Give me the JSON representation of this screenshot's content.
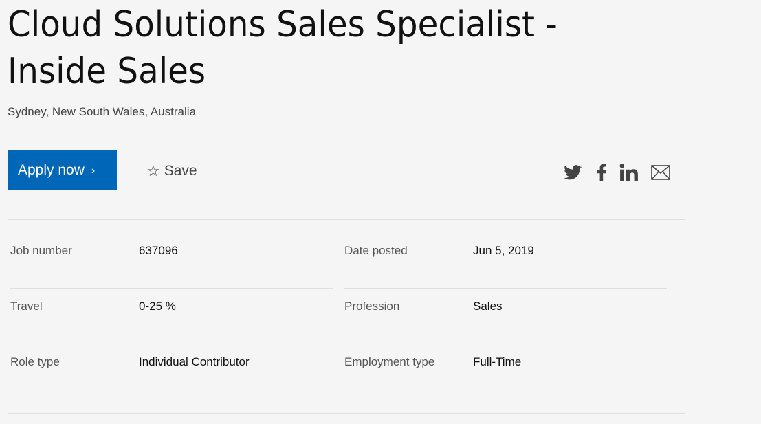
{
  "job": {
    "title": "Cloud Solutions Sales Specialist - Inside Sales",
    "location": "Sydney, New South Wales, Australia"
  },
  "actions": {
    "apply_label": "Apply now",
    "apply_chevron": "›",
    "save_label": "Save",
    "save_icon": "star-outline-icon"
  },
  "share": {
    "icons": [
      "twitter-icon",
      "facebook-icon",
      "linkedin-icon",
      "email-icon"
    ]
  },
  "details": {
    "job_number": {
      "label": "Job number",
      "value": "637096"
    },
    "date_posted": {
      "label": "Date posted",
      "value": "Jun 5, 2019"
    },
    "travel": {
      "label": "Travel",
      "value": "0-25 %"
    },
    "profession": {
      "label": "Profession",
      "value": "Sales"
    },
    "role_type": {
      "label": "Role type",
      "value": "Individual Contributor"
    },
    "employment_type": {
      "label": "Employment type",
      "value": "Full-Time"
    }
  },
  "colors": {
    "accent": "#0067b8",
    "background": "#f5f5f5",
    "icon": "#444444"
  }
}
